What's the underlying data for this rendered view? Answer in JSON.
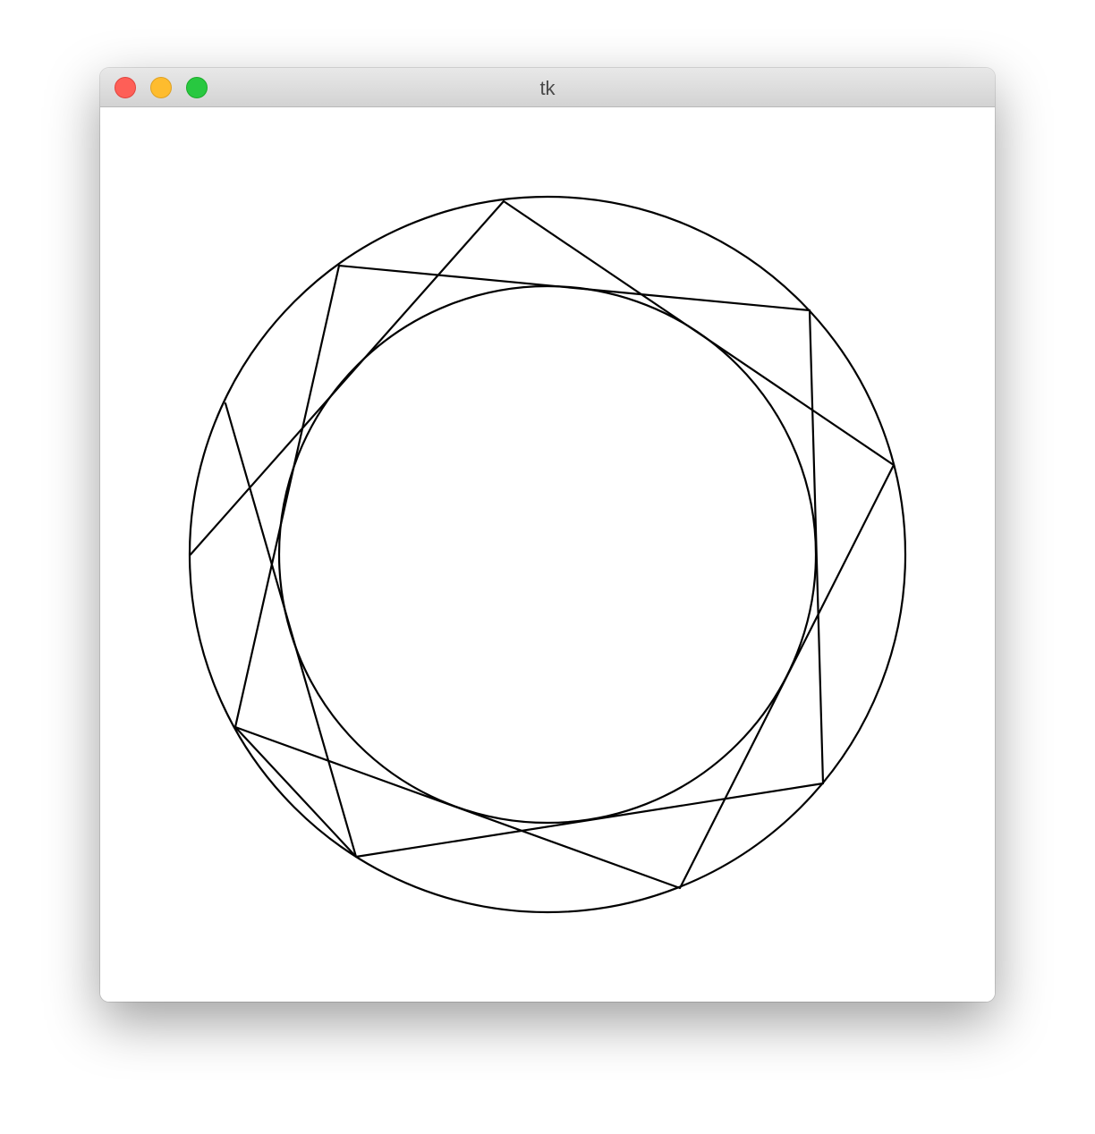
{
  "window": {
    "title": "tk",
    "buttons": {
      "close": "close",
      "minimize": "minimize",
      "zoom": "zoom"
    },
    "colors": {
      "close": "#fe5f57",
      "minimize": "#febc2e",
      "zoom": "#28c840"
    }
  },
  "canvas": {
    "background": "#ffffff",
    "stroke": "#000000"
  }
}
